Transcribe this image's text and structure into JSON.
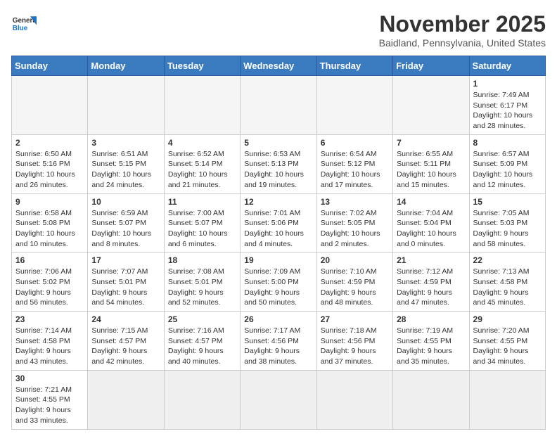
{
  "header": {
    "logo_general": "General",
    "logo_blue": "Blue",
    "month_title": "November 2025",
    "location": "Baidland, Pennsylvania, United States"
  },
  "weekdays": [
    "Sunday",
    "Monday",
    "Tuesday",
    "Wednesday",
    "Thursday",
    "Friday",
    "Saturday"
  ],
  "weeks": [
    [
      {
        "day": "",
        "info": ""
      },
      {
        "day": "",
        "info": ""
      },
      {
        "day": "",
        "info": ""
      },
      {
        "day": "",
        "info": ""
      },
      {
        "day": "",
        "info": ""
      },
      {
        "day": "",
        "info": ""
      },
      {
        "day": "1",
        "info": "Sunrise: 7:49 AM\nSunset: 6:17 PM\nDaylight: 10 hours and 28 minutes."
      }
    ],
    [
      {
        "day": "2",
        "info": "Sunrise: 6:50 AM\nSunset: 5:16 PM\nDaylight: 10 hours and 26 minutes."
      },
      {
        "day": "3",
        "info": "Sunrise: 6:51 AM\nSunset: 5:15 PM\nDaylight: 10 hours and 24 minutes."
      },
      {
        "day": "4",
        "info": "Sunrise: 6:52 AM\nSunset: 5:14 PM\nDaylight: 10 hours and 21 minutes."
      },
      {
        "day": "5",
        "info": "Sunrise: 6:53 AM\nSunset: 5:13 PM\nDaylight: 10 hours and 19 minutes."
      },
      {
        "day": "6",
        "info": "Sunrise: 6:54 AM\nSunset: 5:12 PM\nDaylight: 10 hours and 17 minutes."
      },
      {
        "day": "7",
        "info": "Sunrise: 6:55 AM\nSunset: 5:11 PM\nDaylight: 10 hours and 15 minutes."
      },
      {
        "day": "8",
        "info": "Sunrise: 6:57 AM\nSunset: 5:09 PM\nDaylight: 10 hours and 12 minutes."
      }
    ],
    [
      {
        "day": "9",
        "info": "Sunrise: 6:58 AM\nSunset: 5:08 PM\nDaylight: 10 hours and 10 minutes."
      },
      {
        "day": "10",
        "info": "Sunrise: 6:59 AM\nSunset: 5:07 PM\nDaylight: 10 hours and 8 minutes."
      },
      {
        "day": "11",
        "info": "Sunrise: 7:00 AM\nSunset: 5:07 PM\nDaylight: 10 hours and 6 minutes."
      },
      {
        "day": "12",
        "info": "Sunrise: 7:01 AM\nSunset: 5:06 PM\nDaylight: 10 hours and 4 minutes."
      },
      {
        "day": "13",
        "info": "Sunrise: 7:02 AM\nSunset: 5:05 PM\nDaylight: 10 hours and 2 minutes."
      },
      {
        "day": "14",
        "info": "Sunrise: 7:04 AM\nSunset: 5:04 PM\nDaylight: 10 hours and 0 minutes."
      },
      {
        "day": "15",
        "info": "Sunrise: 7:05 AM\nSunset: 5:03 PM\nDaylight: 9 hours and 58 minutes."
      }
    ],
    [
      {
        "day": "16",
        "info": "Sunrise: 7:06 AM\nSunset: 5:02 PM\nDaylight: 9 hours and 56 minutes."
      },
      {
        "day": "17",
        "info": "Sunrise: 7:07 AM\nSunset: 5:01 PM\nDaylight: 9 hours and 54 minutes."
      },
      {
        "day": "18",
        "info": "Sunrise: 7:08 AM\nSunset: 5:01 PM\nDaylight: 9 hours and 52 minutes."
      },
      {
        "day": "19",
        "info": "Sunrise: 7:09 AM\nSunset: 5:00 PM\nDaylight: 9 hours and 50 minutes."
      },
      {
        "day": "20",
        "info": "Sunrise: 7:10 AM\nSunset: 4:59 PM\nDaylight: 9 hours and 48 minutes."
      },
      {
        "day": "21",
        "info": "Sunrise: 7:12 AM\nSunset: 4:59 PM\nDaylight: 9 hours and 47 minutes."
      },
      {
        "day": "22",
        "info": "Sunrise: 7:13 AM\nSunset: 4:58 PM\nDaylight: 9 hours and 45 minutes."
      }
    ],
    [
      {
        "day": "23",
        "info": "Sunrise: 7:14 AM\nSunset: 4:58 PM\nDaylight: 9 hours and 43 minutes."
      },
      {
        "day": "24",
        "info": "Sunrise: 7:15 AM\nSunset: 4:57 PM\nDaylight: 9 hours and 42 minutes."
      },
      {
        "day": "25",
        "info": "Sunrise: 7:16 AM\nSunset: 4:57 PM\nDaylight: 9 hours and 40 minutes."
      },
      {
        "day": "26",
        "info": "Sunrise: 7:17 AM\nSunset: 4:56 PM\nDaylight: 9 hours and 38 minutes."
      },
      {
        "day": "27",
        "info": "Sunrise: 7:18 AM\nSunset: 4:56 PM\nDaylight: 9 hours and 37 minutes."
      },
      {
        "day": "28",
        "info": "Sunrise: 7:19 AM\nSunset: 4:55 PM\nDaylight: 9 hours and 35 minutes."
      },
      {
        "day": "29",
        "info": "Sunrise: 7:20 AM\nSunset: 4:55 PM\nDaylight: 9 hours and 34 minutes."
      }
    ],
    [
      {
        "day": "30",
        "info": "Sunrise: 7:21 AM\nSunset: 4:55 PM\nDaylight: 9 hours and 33 minutes."
      },
      {
        "day": "",
        "info": ""
      },
      {
        "day": "",
        "info": ""
      },
      {
        "day": "",
        "info": ""
      },
      {
        "day": "",
        "info": ""
      },
      {
        "day": "",
        "info": ""
      },
      {
        "day": "",
        "info": ""
      }
    ]
  ]
}
